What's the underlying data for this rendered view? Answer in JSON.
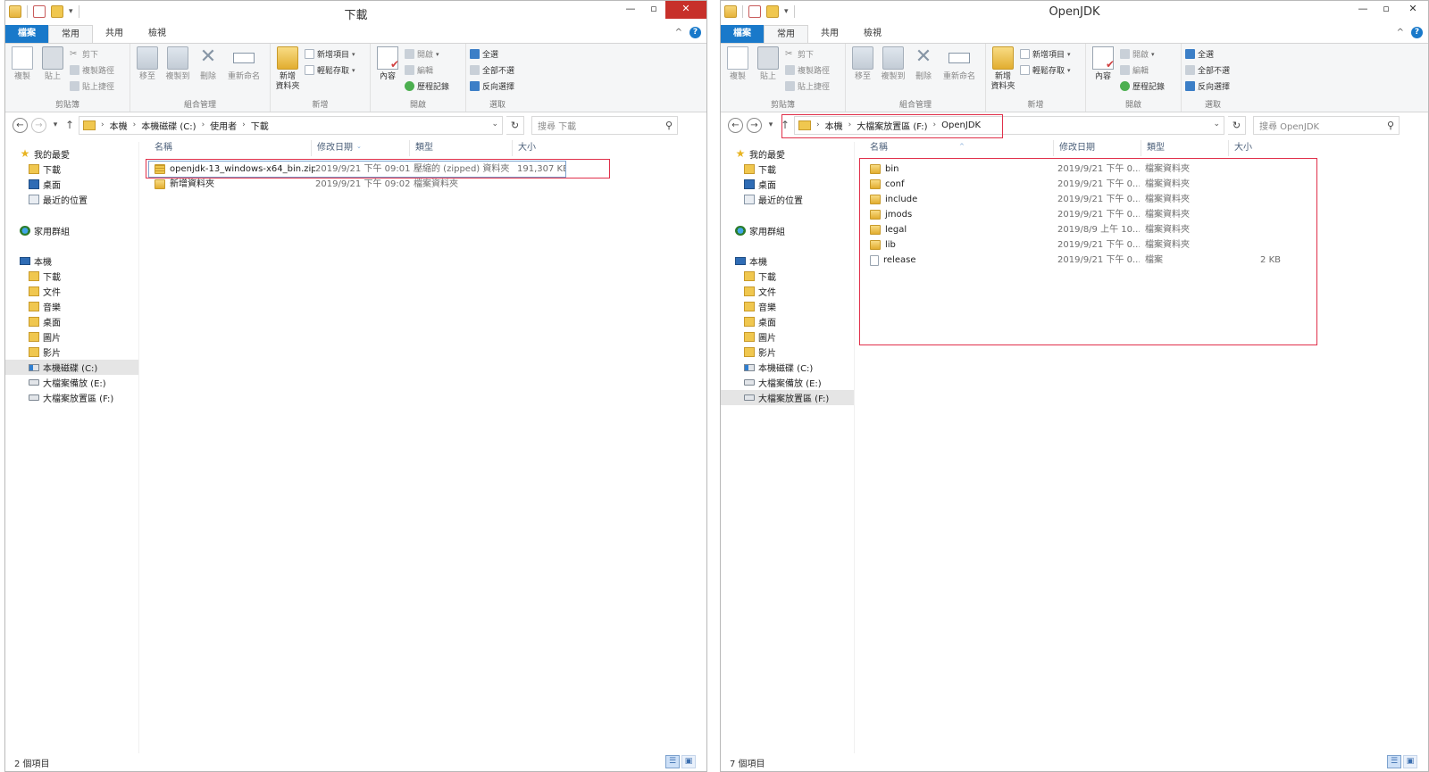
{
  "ribbon": {
    "tabs": [
      "檔案",
      "常用",
      "共用",
      "檢視"
    ],
    "groups": {
      "clipboard": {
        "label": "剪貼簿",
        "copy": "複製",
        "paste": "貼上",
        "cut": "剪下",
        "copy_path": "複製路徑",
        "paste_shortcut": "貼上捷徑"
      },
      "organize": {
        "label": "組合管理",
        "move_to": "移至",
        "copy_to": "複製到",
        "delete": "刪除",
        "rename": "重新命名"
      },
      "new": {
        "label": "新增",
        "new_folder_1": "新增",
        "new_folder_2": "資料夾",
        "new_item": "新增項目",
        "easy_access": "輕鬆存取"
      },
      "open": {
        "label": "開啟",
        "properties": "內容",
        "open": "開啟",
        "edit": "編輯",
        "history": "歷程記錄"
      },
      "select": {
        "label": "選取",
        "select_all": "全選",
        "select_none": "全部不選",
        "invert": "反向選擇"
      }
    }
  },
  "navpane": {
    "favorites": "我的最愛",
    "downloads": "下載",
    "desktop": "桌面",
    "recent": "最近的位置",
    "homegroup": "家用群組",
    "this_pc": "本機",
    "pc_items": [
      "下載",
      "文件",
      "音樂",
      "桌面",
      "圖片",
      "影片"
    ],
    "drive_c": "本機磁碟 (C:)",
    "drive_e": "大檔案備放 (E:)",
    "drive_f": "大檔案放置區 (F:)"
  },
  "columns": {
    "name": "名稱",
    "date": "修改日期",
    "type": "類型",
    "size": "大小"
  },
  "left_window": {
    "title": "下載",
    "breadcrumb": [
      "本機",
      "本機磁碟 (C:)",
      "使用者",
      "下載"
    ],
    "search_placeholder": "搜尋 下載",
    "files": [
      {
        "name": "openjdk-13_windows-x64_bin.zip",
        "date": "2019/9/21 下午 09:01",
        "type": "壓縮的 (zipped) 資料夾",
        "size": "191,307 KB",
        "icon": "zip-folder-icon"
      },
      {
        "name": "新增資料夾",
        "date": "2019/9/21 下午 09:02",
        "type": "檔案資料夾",
        "size": "",
        "icon": "folder-icon"
      }
    ],
    "status": "2 個項目"
  },
  "right_window": {
    "title": "OpenJDK",
    "breadcrumb": [
      "本機",
      "大檔案放置區 (F:)",
      "OpenJDK"
    ],
    "search_placeholder": "搜尋 OpenJDK",
    "files": [
      {
        "name": "bin",
        "date": "2019/9/21 下午 0...",
        "type": "檔案資料夾",
        "size": "",
        "icon": "folder-icon"
      },
      {
        "name": "conf",
        "date": "2019/9/21 下午 0...",
        "type": "檔案資料夾",
        "size": "",
        "icon": "folder-icon"
      },
      {
        "name": "include",
        "date": "2019/9/21 下午 0...",
        "type": "檔案資料夾",
        "size": "",
        "icon": "folder-icon"
      },
      {
        "name": "jmods",
        "date": "2019/9/21 下午 0...",
        "type": "檔案資料夾",
        "size": "",
        "icon": "folder-icon"
      },
      {
        "name": "legal",
        "date": "2019/8/9 上午 10...",
        "type": "檔案資料夾",
        "size": "",
        "icon": "folder-icon"
      },
      {
        "name": "lib",
        "date": "2019/9/21 下午 0...",
        "type": "檔案資料夾",
        "size": "",
        "icon": "folder-icon"
      },
      {
        "name": "release",
        "date": "2019/9/21 下午 0...",
        "type": "檔案",
        "size": "2 KB",
        "icon": "file-icon"
      }
    ],
    "status": "7 個項目"
  },
  "colors": {
    "file_tab": "#1979ca",
    "close_button": "#c7302a",
    "highlight": "#e0304a"
  }
}
